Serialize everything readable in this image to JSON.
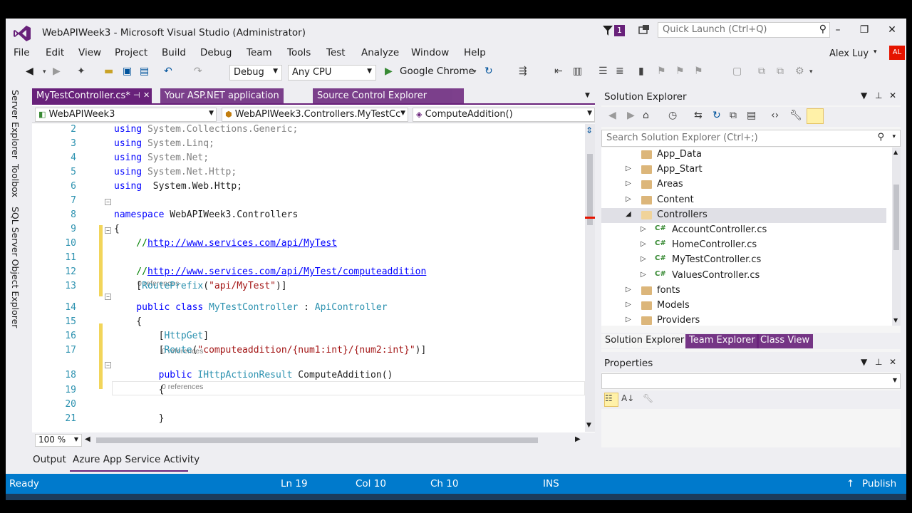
{
  "window": {
    "title": "WebAPIWeek3 - Microsoft Visual Studio (Administrator)",
    "notification_count": "1",
    "quick_launch_placeholder": "Quick Launch (Ctrl+Q)",
    "minimize": "–",
    "restore": "❐",
    "close": "✕"
  },
  "menu": [
    "File",
    "Edit",
    "View",
    "Project",
    "Build",
    "Debug",
    "Team",
    "Tools",
    "Test",
    "Analyze",
    "Window",
    "Help"
  ],
  "user": {
    "name": "Alex Luy",
    "initials": "AL"
  },
  "toolbar": {
    "config": "Debug",
    "platform": "Any CPU",
    "run_target": "Google Chrome"
  },
  "side_tabs": [
    "Server Explorer",
    "Toolbox",
    "SQL Server Object Explorer"
  ],
  "editor": {
    "tabs": [
      {
        "label": "MyTestController.cs*",
        "active": true
      },
      {
        "label": "Your ASP.NET application",
        "active": false
      },
      {
        "label": "Source Control Explorer",
        "active": false
      }
    ],
    "nav": {
      "project": "WebAPIWeek3",
      "class": "WebAPIWeek3.Controllers.MyTestCc",
      "member": "ComputeAddition()"
    },
    "lines": [
      {
        "n": "2",
        "parts": [
          [
            "kw",
            "using"
          ],
          [
            "gy",
            " System.Collections.Generic;"
          ]
        ]
      },
      {
        "n": "3",
        "parts": [
          [
            "kw",
            "using"
          ],
          [
            "gy",
            " System.Linq;"
          ]
        ]
      },
      {
        "n": "4",
        "parts": [
          [
            "kw",
            "using"
          ],
          [
            "gy",
            " System.Net;"
          ]
        ]
      },
      {
        "n": "5",
        "parts": [
          [
            "kw",
            "using"
          ],
          [
            "gy",
            " System.Net.Http;"
          ]
        ]
      },
      {
        "n": "6",
        "parts": [
          [
            "kw",
            "using"
          ],
          [
            "",
            "  System.Web.Http;"
          ]
        ]
      },
      {
        "n": "7",
        "parts": []
      },
      {
        "n": "8",
        "parts": [
          [
            "kw",
            "namespace"
          ],
          [
            "",
            " WebAPIWeek3.Controllers"
          ]
        ]
      },
      {
        "n": "9",
        "parts": [
          [
            "",
            "{"
          ]
        ]
      },
      {
        "n": "10",
        "parts": [
          [
            "cm",
            "    //"
          ],
          [
            "lnk",
            "http://www.services.com/api/MyTest"
          ]
        ]
      },
      {
        "n": "11",
        "parts": []
      },
      {
        "n": "12",
        "parts": [
          [
            "cm",
            "    //"
          ],
          [
            "lnk",
            "http://www.services.com/api/MyTest/computeaddition"
          ]
        ]
      },
      {
        "n": "13",
        "parts": [
          [
            "",
            "    ["
          ],
          [
            "ty",
            "RoutePrefix"
          ],
          [
            "",
            "("
          ],
          [
            "st",
            "\"api/MyTest\""
          ],
          [
            "",
            ")]"
          ]
        ]
      },
      {
        "n": "14",
        "parts": [
          [
            "kw",
            "    public class "
          ],
          [
            "ty",
            "MyTestController"
          ],
          [
            "",
            " : "
          ],
          [
            "ty",
            "ApiController"
          ]
        ]
      },
      {
        "n": "15",
        "parts": [
          [
            "",
            "    {"
          ]
        ]
      },
      {
        "n": "16",
        "parts": [
          [
            "",
            "        ["
          ],
          [
            "ty",
            "HttpGet"
          ],
          [
            "",
            "]"
          ]
        ]
      },
      {
        "n": "17",
        "parts": [
          [
            "",
            "        ["
          ],
          [
            "ty",
            "Route"
          ],
          [
            "",
            "("
          ],
          [
            "st",
            "\"computeaddition/{num1:int}/{num2:int}\""
          ],
          [
            "",
            ")]"
          ]
        ]
      },
      {
        "n": "18",
        "parts": [
          [
            "kw",
            "        public "
          ],
          [
            "ty",
            "IHttpActionResult"
          ],
          [
            "",
            " ComputeAddition()"
          ]
        ]
      },
      {
        "n": "19",
        "parts": [
          [
            "",
            "        {"
          ]
        ]
      },
      {
        "n": "20",
        "parts": []
      },
      {
        "n": "21",
        "parts": [
          [
            "",
            "        }"
          ]
        ]
      }
    ],
    "references_label": "0 references",
    "zoom": "100 %"
  },
  "solution_explorer": {
    "title": "Solution Explorer",
    "search_placeholder": "Search Solution Explorer (Ctrl+;)",
    "items": [
      {
        "label": "App_Data",
        "type": "folder",
        "indent": 0,
        "arrow": ""
      },
      {
        "label": "App_Start",
        "type": "folder",
        "indent": 0,
        "arrow": "▷"
      },
      {
        "label": "Areas",
        "type": "folder",
        "indent": 0,
        "arrow": "▷"
      },
      {
        "label": "Content",
        "type": "folder",
        "indent": 0,
        "arrow": "▷"
      },
      {
        "label": "Controllers",
        "type": "folder-open",
        "indent": 0,
        "arrow": "◢",
        "selected": true
      },
      {
        "label": "AccountController.cs",
        "type": "cs",
        "indent": 1,
        "arrow": "▷"
      },
      {
        "label": "HomeController.cs",
        "type": "cs",
        "indent": 1,
        "arrow": "▷"
      },
      {
        "label": "MyTestController.cs",
        "type": "cs",
        "indent": 1,
        "arrow": "▷"
      },
      {
        "label": "ValuesController.cs",
        "type": "cs",
        "indent": 1,
        "arrow": "▷"
      },
      {
        "label": "fonts",
        "type": "folder",
        "indent": 0,
        "arrow": "▷"
      },
      {
        "label": "Models",
        "type": "folder",
        "indent": 0,
        "arrow": "▷"
      },
      {
        "label": "Providers",
        "type": "folder",
        "indent": 0,
        "arrow": "▷"
      }
    ],
    "tabs": [
      "Solution Explorer",
      "Team Explorer",
      "Class View"
    ],
    "cs_badge": "C#"
  },
  "properties": {
    "title": "Properties"
  },
  "bottom_tabs": [
    "Output",
    "Azure App Service Activity"
  ],
  "status": {
    "ready": "Ready",
    "ln": "Ln 19",
    "col": "Col 10",
    "ch": "Ch 10",
    "ins": "INS",
    "publish": "Publish"
  }
}
